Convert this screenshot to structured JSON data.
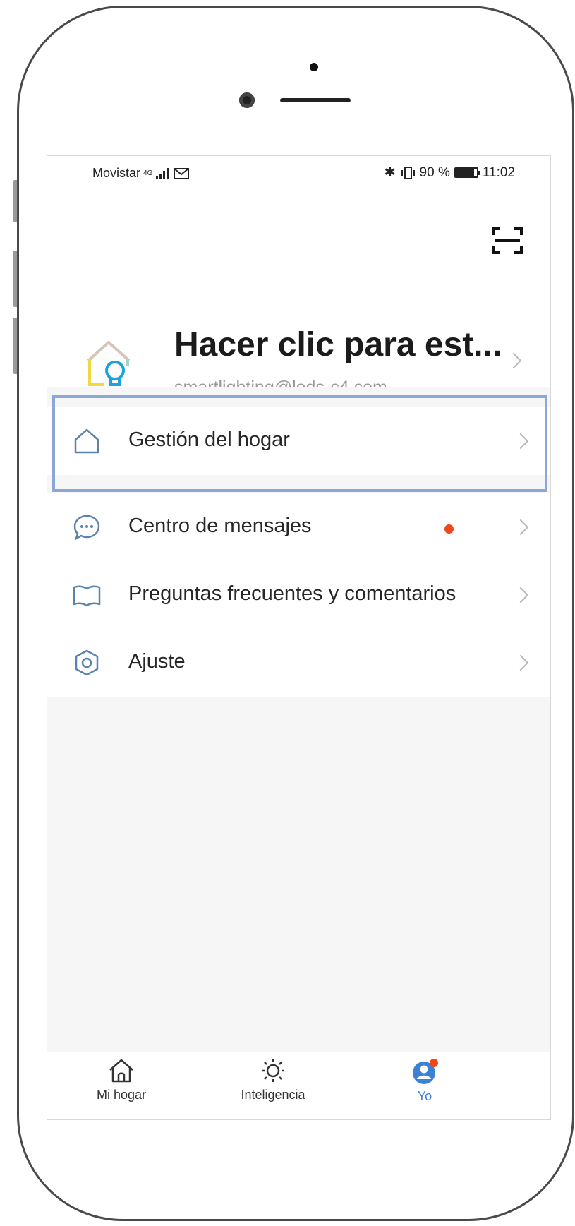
{
  "status_bar": {
    "carrier": "Movistar",
    "network": "4G",
    "battery_percent": "90 %",
    "time": "11:02"
  },
  "profile": {
    "name": "Hacer clic para est...",
    "email": "smartlighting@leds-c4.com"
  },
  "menu": {
    "home_management": "Gestión del hogar",
    "messages": "Centro de mensajes",
    "faq": "Preguntas frecuentes y comentarios",
    "settings": "Ajuste"
  },
  "tabs": {
    "home": "Mi hogar",
    "smart": "Inteligencia",
    "me": "Yo"
  },
  "colors": {
    "accent": "#3b82d6",
    "notification": "#f2461a",
    "highlight": "#8aa7d8"
  },
  "icons": [
    "scan-icon",
    "house-icon",
    "chat-bubble-icon",
    "book-icon",
    "hexagon-settings-icon",
    "sun-icon",
    "user-icon",
    "chevron-right-icon"
  ]
}
